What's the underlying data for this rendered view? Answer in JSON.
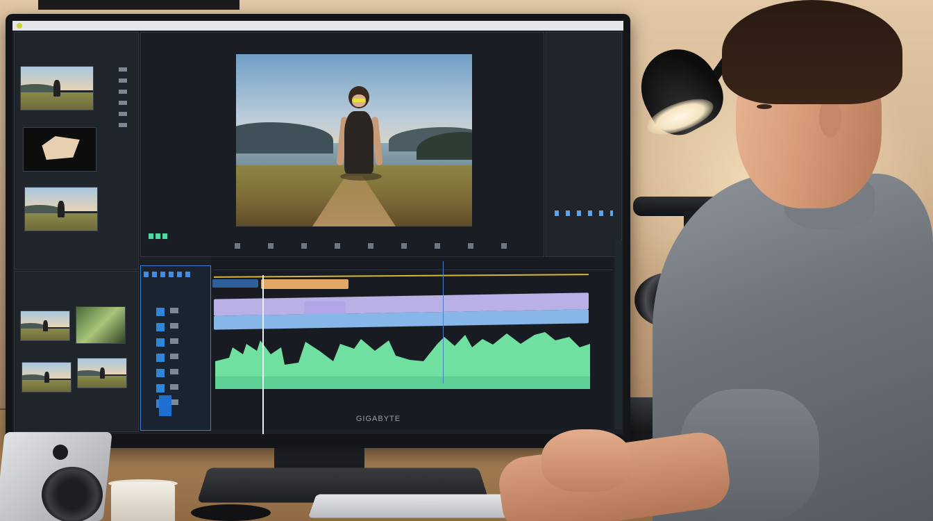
{
  "caption": {
    "text": ""
  },
  "monitor": {
    "brand": "GIGABYTE"
  },
  "colors": {
    "accent_blue": "#3d7bd4",
    "waveform_green": "#6fe0a0",
    "clip_orange": "#e2a865",
    "clip_lavender": "#b9b0e6",
    "clip_blue": "#87b6e8",
    "ruler_yellow": "#d6b634",
    "camera_ring_blue": "#2e7fd8",
    "camera_status_green": "#3fe27a"
  },
  "icons": {
    "lamp": "desk-lamp-icon",
    "camera": "video-camera-icon",
    "speaker": "speaker-icon"
  }
}
